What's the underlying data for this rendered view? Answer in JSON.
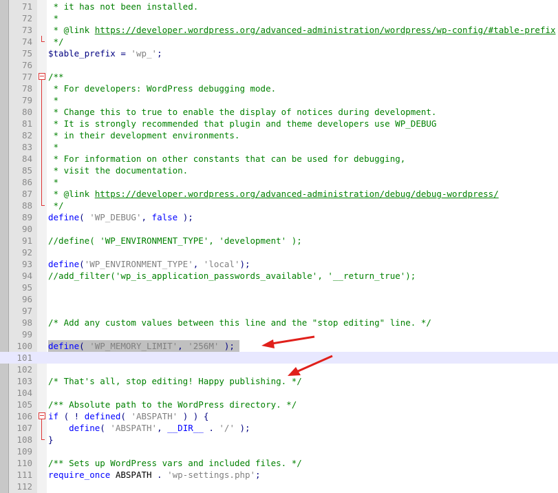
{
  "accent": {
    "arrow": "#e0201b",
    "fold_marker": "#dd3333",
    "comment": "#008000",
    "keyword": "#0000ff",
    "string": "#808080",
    "selection": "#c0c0c0"
  },
  "lines": [
    {
      "n": "71",
      "tokens": [
        {
          "t": " * it has not been installed.",
          "c": "c"
        }
      ]
    },
    {
      "n": "72",
      "tokens": [
        {
          "t": " *",
          "c": "c"
        }
      ]
    },
    {
      "n": "73",
      "tokens": [
        {
          "t": " * @link ",
          "c": "c"
        },
        {
          "t": "https://developer.wordpress.org/advanced-administration/wordpress/wp-config/#table-prefix",
          "c": "u"
        }
      ]
    },
    {
      "n": "74",
      "fold": "end",
      "tokens": [
        {
          "t": " */",
          "c": "c"
        }
      ]
    },
    {
      "n": "75",
      "tokens": [
        {
          "t": "$table_prefix",
          "c": "v"
        },
        {
          "t": " = ",
          "c": "o"
        },
        {
          "t": "'wp_'",
          "c": "s"
        },
        {
          "t": ";",
          "c": "o"
        }
      ]
    },
    {
      "n": "76",
      "tokens": []
    },
    {
      "n": "77",
      "fold": "box",
      "tokens": [
        {
          "t": "/**",
          "c": "c"
        }
      ]
    },
    {
      "n": "78",
      "fold": "vl",
      "tokens": [
        {
          "t": " * For developers: WordPress debugging mode.",
          "c": "c"
        }
      ]
    },
    {
      "n": "79",
      "fold": "vl",
      "tokens": [
        {
          "t": " *",
          "c": "c"
        }
      ]
    },
    {
      "n": "80",
      "fold": "vl",
      "tokens": [
        {
          "t": " * Change this to true to enable the display of notices during development.",
          "c": "c"
        }
      ]
    },
    {
      "n": "81",
      "fold": "vl",
      "tokens": [
        {
          "t": " * It is strongly recommended that plugin and theme developers use WP_DEBUG",
          "c": "c"
        }
      ]
    },
    {
      "n": "82",
      "fold": "vl",
      "tokens": [
        {
          "t": " * in their development environments.",
          "c": "c"
        }
      ]
    },
    {
      "n": "83",
      "fold": "vl",
      "tokens": [
        {
          "t": " *",
          "c": "c"
        }
      ]
    },
    {
      "n": "84",
      "fold": "vl",
      "tokens": [
        {
          "t": " * For information on other constants that can be used for debugging,",
          "c": "c"
        }
      ]
    },
    {
      "n": "85",
      "fold": "vl",
      "tokens": [
        {
          "t": " * visit the documentation.",
          "c": "c"
        }
      ]
    },
    {
      "n": "86",
      "fold": "vl",
      "tokens": [
        {
          "t": " *",
          "c": "c"
        }
      ]
    },
    {
      "n": "87",
      "fold": "vl",
      "tokens": [
        {
          "t": " * @link ",
          "c": "c"
        },
        {
          "t": "https://developer.wordpress.org/advanced-administration/debug/debug-wordpress/",
          "c": "u"
        }
      ]
    },
    {
      "n": "88",
      "fold": "end",
      "tokens": [
        {
          "t": " */",
          "c": "c"
        }
      ]
    },
    {
      "n": "89",
      "tokens": [
        {
          "t": "define",
          "c": "k"
        },
        {
          "t": "( ",
          "c": "o"
        },
        {
          "t": "'WP_DEBUG'",
          "c": "s"
        },
        {
          "t": ", ",
          "c": "o"
        },
        {
          "t": "false",
          "c": "k"
        },
        {
          "t": " );",
          "c": "o"
        }
      ]
    },
    {
      "n": "90",
      "tokens": []
    },
    {
      "n": "91",
      "tokens": [
        {
          "t": "//define( 'WP_ENVIRONMENT_TYPE', 'development' );",
          "c": "c"
        }
      ]
    },
    {
      "n": "92",
      "tokens": []
    },
    {
      "n": "93",
      "tokens": [
        {
          "t": "define",
          "c": "k"
        },
        {
          "t": "(",
          "c": "o"
        },
        {
          "t": "'WP_ENVIRONMENT_TYPE'",
          "c": "s"
        },
        {
          "t": ", ",
          "c": "o"
        },
        {
          "t": "'local'",
          "c": "s"
        },
        {
          "t": ");",
          "c": "o"
        }
      ]
    },
    {
      "n": "94",
      "tokens": [
        {
          "t": "//add_filter('wp_is_application_passwords_available', '__return_true');",
          "c": "c"
        }
      ]
    },
    {
      "n": "95",
      "tokens": []
    },
    {
      "n": "96",
      "tokens": []
    },
    {
      "n": "97",
      "tokens": []
    },
    {
      "n": "98",
      "tokens": [
        {
          "t": "/* Add any custom values between this line and the \"stop editing\" line. */",
          "c": "c"
        }
      ]
    },
    {
      "n": "99",
      "tokens": []
    },
    {
      "n": "100",
      "selected": true,
      "tokens": [
        {
          "t": "define",
          "c": "k"
        },
        {
          "t": "( ",
          "c": "o"
        },
        {
          "t": "'WP_MEMORY_LIMIT'",
          "c": "s"
        },
        {
          "t": ", ",
          "c": "o"
        },
        {
          "t": "'256M'",
          "c": "s"
        },
        {
          "t": " );",
          "c": "o"
        },
        {
          "t": " ",
          "c": "o"
        }
      ]
    },
    {
      "n": "101",
      "current": true,
      "tokens": []
    },
    {
      "n": "102",
      "tokens": []
    },
    {
      "n": "103",
      "tokens": [
        {
          "t": "/* That's all, stop editing! Happy publishing. */",
          "c": "c"
        }
      ]
    },
    {
      "n": "104",
      "tokens": []
    },
    {
      "n": "105",
      "tokens": [
        {
          "t": "/** Absolute path to the WordPress directory. */",
          "c": "c"
        }
      ]
    },
    {
      "n": "106",
      "fold": "box",
      "tokens": [
        {
          "t": "if",
          "c": "k"
        },
        {
          "t": " ( ! ",
          "c": "o"
        },
        {
          "t": "defined",
          "c": "k"
        },
        {
          "t": "( ",
          "c": "o"
        },
        {
          "t": "'ABSPATH'",
          "c": "s"
        },
        {
          "t": " ) ) {",
          "c": "o"
        }
      ]
    },
    {
      "n": "107",
      "fold": "vl",
      "tokens": [
        {
          "t": "    define",
          "c": "k"
        },
        {
          "t": "( ",
          "c": "o"
        },
        {
          "t": "'ABSPATH'",
          "c": "s"
        },
        {
          "t": ", ",
          "c": "o"
        },
        {
          "t": "__DIR__",
          "c": "k"
        },
        {
          "t": " . ",
          "c": "o"
        },
        {
          "t": "'/'",
          "c": "s"
        },
        {
          "t": " );",
          "c": "o"
        }
      ]
    },
    {
      "n": "108",
      "fold": "end",
      "tokens": [
        {
          "t": "}",
          "c": "o"
        }
      ]
    },
    {
      "n": "109",
      "tokens": []
    },
    {
      "n": "110",
      "tokens": [
        {
          "t": "/** Sets up WordPress vars and included files. */",
          "c": "c"
        }
      ]
    },
    {
      "n": "111",
      "tokens": [
        {
          "t": "require_once",
          "c": "k"
        },
        {
          "t": " ABSPATH ",
          "c": "p"
        },
        {
          "t": ". ",
          "c": "o"
        },
        {
          "t": "'wp-settings.php'",
          "c": "s"
        },
        {
          "t": ";",
          "c": "o"
        }
      ]
    },
    {
      "n": "112",
      "tokens": []
    }
  ]
}
